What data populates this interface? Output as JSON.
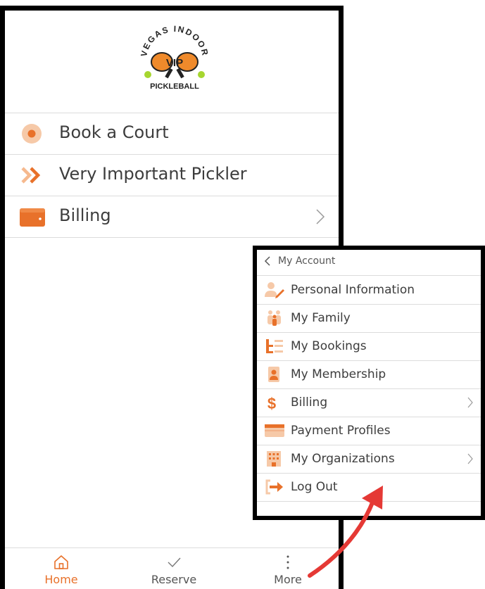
{
  "logo": {
    "top_text": "VEGAS INDOOR",
    "center_text": "VIP",
    "bottom_text": "PICKLEBALL"
  },
  "menu": [
    {
      "label": "Book a Court",
      "icon": "radio-dot-icon"
    },
    {
      "label": "Very Important Pickler",
      "icon": "double-chevron-icon"
    },
    {
      "label": "Billing",
      "icon": "wallet-icon",
      "has_chevron": true
    }
  ],
  "bottom_nav": [
    {
      "label": "Home",
      "icon": "home-icon",
      "active": true
    },
    {
      "label": "Reserve",
      "icon": "checkmark-icon",
      "active": false
    },
    {
      "label": "More",
      "icon": "more-vertical-icon",
      "active": false
    }
  ],
  "account_panel": {
    "back_label": "My Account",
    "items": [
      {
        "label": "Personal Information",
        "icon": "user-edit-icon"
      },
      {
        "label": "My Family",
        "icon": "family-icon"
      },
      {
        "label": "My Bookings",
        "icon": "list-icon"
      },
      {
        "label": "My Membership",
        "icon": "membership-card-icon"
      },
      {
        "label": "Billing",
        "icon": "dollar-icon",
        "has_chevron": true
      },
      {
        "label": "Payment Profiles",
        "icon": "credit-card-icon"
      },
      {
        "label": "My Organizations",
        "icon": "building-icon",
        "has_chevron": true
      },
      {
        "label": "Log Out",
        "icon": "logout-icon"
      }
    ]
  },
  "colors": {
    "accent": "#e8712a",
    "accent_light": "#f6c9a8",
    "annotation_arrow": "#e53935",
    "divider": "#dcdcdc"
  }
}
